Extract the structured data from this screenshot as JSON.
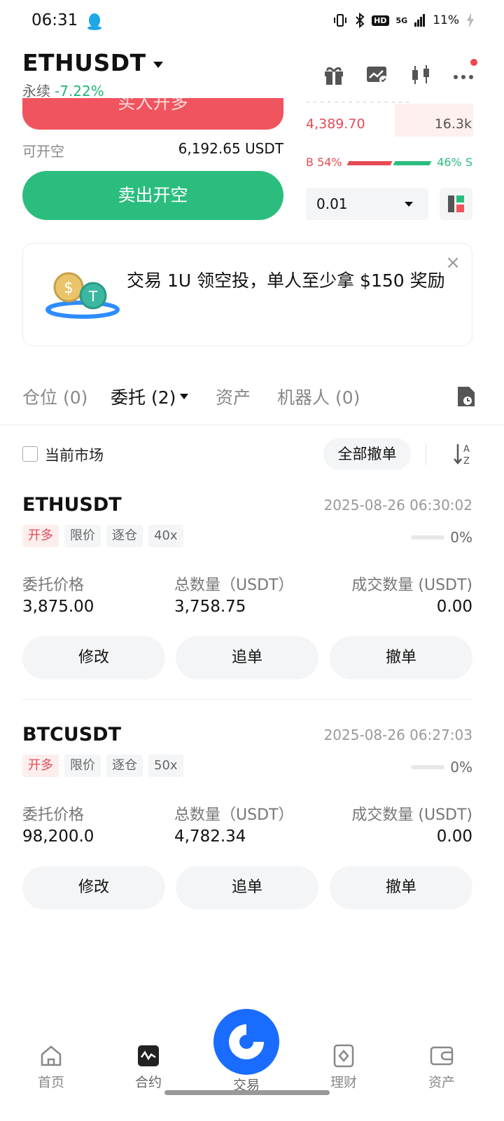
{
  "status_bar": {
    "time": "06:31",
    "network": "5G",
    "hd": "HD",
    "battery": "11%"
  },
  "header": {
    "symbol": "ETHUSDT",
    "contract_type": "永续",
    "change": "-7.22%"
  },
  "trade": {
    "buy_label": "买入开多",
    "avail_label": "可开空",
    "avail_value": "6,192.65 USDT",
    "sell_label": "卖出开空"
  },
  "orderbook": {
    "price": "4,389.70",
    "qty": "16.3k",
    "buy_ratio": "B 54%",
    "sell_ratio": "46% S",
    "buy_pct": 54,
    "sell_pct": 46,
    "step": "0.01"
  },
  "promo": {
    "text": "交易 1U 领空投，单人至少拿 $150 奖励",
    "close": "×"
  },
  "tabs": {
    "positions": "仓位 (0)",
    "orders": "委托 (2)",
    "assets": "资产",
    "bots": "机器人 (0)"
  },
  "filter": {
    "current_market": "当前市场",
    "cancel_all": "全部撤单"
  },
  "orders": [
    {
      "symbol": "ETHUSDT",
      "time": "2025-08-26 06:30:02",
      "tags": [
        "开多",
        "限价",
        "逐仓",
        "40x"
      ],
      "progress": "0%",
      "price_label": "委托价格",
      "price": "3,875.00",
      "total_label": "总数量（USDT）",
      "total": "3,758.75",
      "filled_label": "成交数量 (USDT)",
      "filled": "0.00",
      "btn_modify": "修改",
      "btn_chase": "追单",
      "btn_cancel": "撤单"
    },
    {
      "symbol": "BTCUSDT",
      "time": "2025-08-26 06:27:03",
      "tags": [
        "开多",
        "限价",
        "逐仓",
        "50x"
      ],
      "progress": "0%",
      "price_label": "委托价格",
      "price": "98,200.0",
      "total_label": "总数量（USDT）",
      "total": "4,782.34",
      "filled_label": "成交数量 (USDT)",
      "filled": "0.00",
      "btn_modify": "修改",
      "btn_chase": "追单",
      "btn_cancel": "撤单"
    }
  ],
  "nav": {
    "home": "首页",
    "contract": "合约",
    "trade": "交易",
    "finance": "理财",
    "assets": "资产"
  },
  "colors": {
    "buy": "#2bbd7e",
    "sell": "#f0545e",
    "brand": "#1a6cff"
  }
}
